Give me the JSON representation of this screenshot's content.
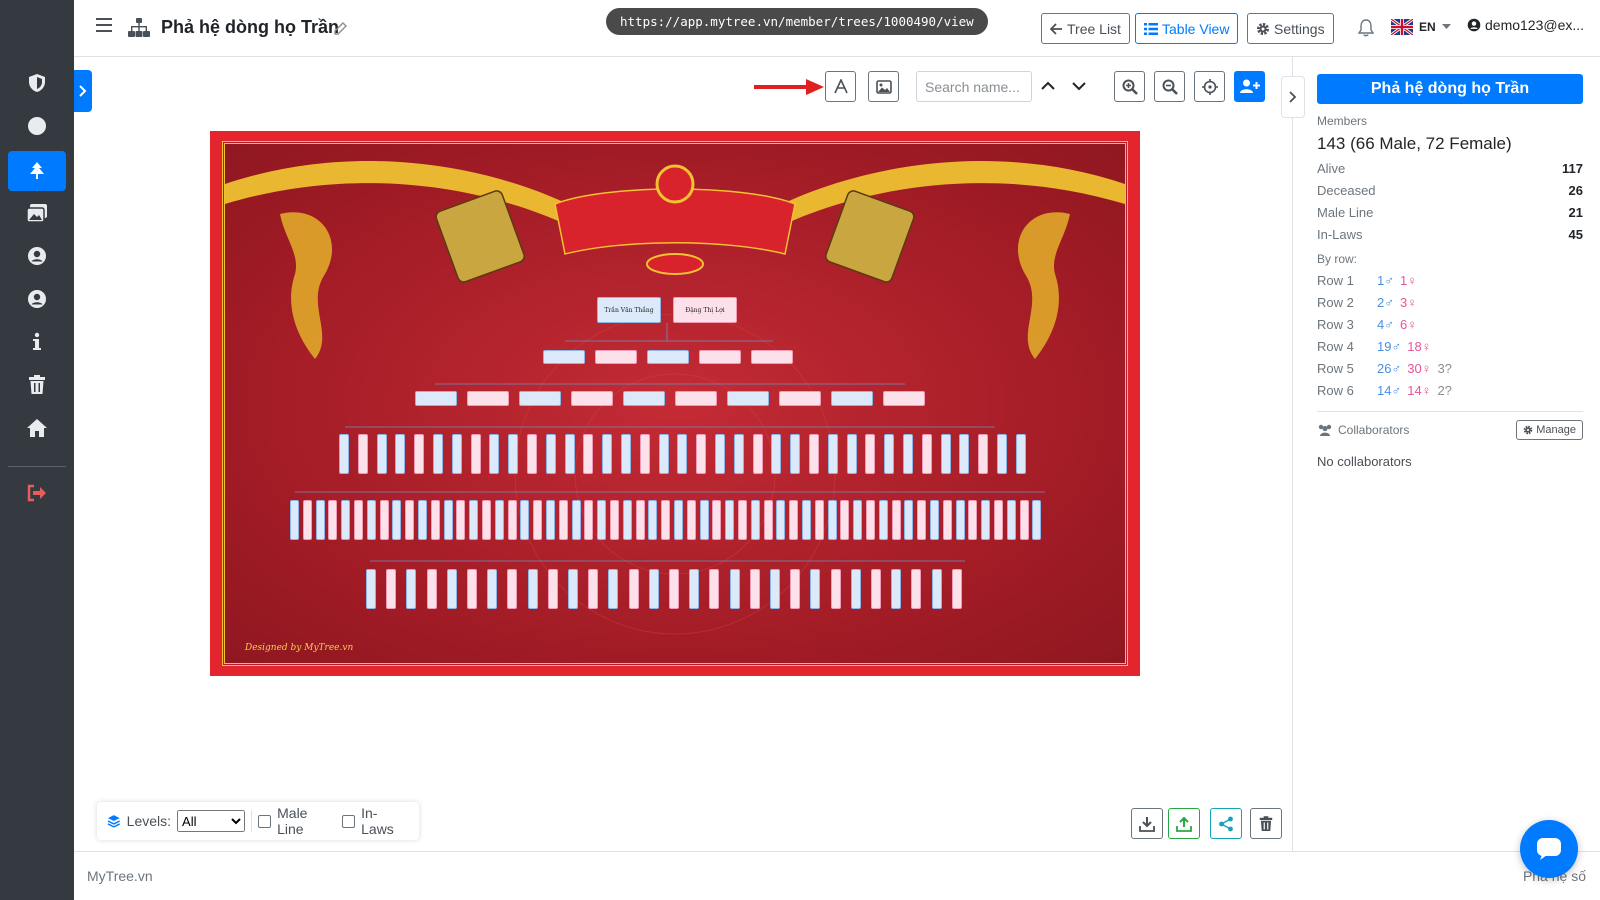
{
  "app": {
    "title": "Phả hệ dòng họ Trần",
    "url": "https://app.mytree.vn/member/trees/1000490/view"
  },
  "header": {
    "tree_list_label": "Tree List",
    "table_view_label": "Table View",
    "settings_label": "Settings",
    "language": "EN",
    "user": "demo123@ex..."
  },
  "sidebar": {
    "items": [
      {
        "icon": "shield-icon"
      },
      {
        "icon": "circle-icon"
      },
      {
        "icon": "tree-icon",
        "active": true
      },
      {
        "icon": "images-icon"
      },
      {
        "icon": "user-circle-icon"
      },
      {
        "icon": "user-circle-icon"
      },
      {
        "icon": "info-icon"
      },
      {
        "icon": "trash-icon"
      },
      {
        "icon": "home-icon"
      },
      {
        "icon": "logout-icon"
      }
    ]
  },
  "toolbar": {
    "search_placeholder": "Search name..."
  },
  "canvas": {
    "signature": "Designed by MyTree.vn",
    "root_couple": [
      "Trần Văn Thắng",
      "Đặng Thị Lợi"
    ]
  },
  "bottom_bar": {
    "levels_label": "Levels:",
    "levels_selected": "All",
    "male_line_label": "Male Line",
    "in_laws_label": "In-Laws"
  },
  "panel": {
    "title": "Phả hệ dòng họ Trần",
    "members_label": "Members",
    "members_value": "143 (66 Male, 72 Female)",
    "stats": [
      {
        "label": "Alive",
        "value": "117"
      },
      {
        "label": "Deceased",
        "value": "26"
      },
      {
        "label": "Male Line",
        "value": "21"
      },
      {
        "label": "In-Laws",
        "value": "45"
      }
    ],
    "by_row_label": "By row:",
    "rows": [
      {
        "label": "Row 1",
        "male": "1♂",
        "female": "1♀",
        "unknown": ""
      },
      {
        "label": "Row 2",
        "male": "2♂",
        "female": "3♀",
        "unknown": ""
      },
      {
        "label": "Row 3",
        "male": "4♂",
        "female": "6♀",
        "unknown": ""
      },
      {
        "label": "Row 4",
        "male": "19♂",
        "female": "18♀",
        "unknown": ""
      },
      {
        "label": "Row 5",
        "male": "26♂",
        "female": "30♀",
        "unknown": "3?"
      },
      {
        "label": "Row 6",
        "male": "14♂",
        "female": "14♀",
        "unknown": "2?"
      }
    ],
    "collaborators_label": "Collaborators",
    "manage_label": "Manage",
    "no_collaborators": "No collaborators"
  },
  "footer": {
    "left": "MyTree.vn",
    "right": "Phả hệ số"
  },
  "colors": {
    "primary": "#007bff",
    "sidebar_bg": "#343a40",
    "frame_red": "#e5252d",
    "male": "#4a90e2",
    "female": "#e8559a"
  }
}
